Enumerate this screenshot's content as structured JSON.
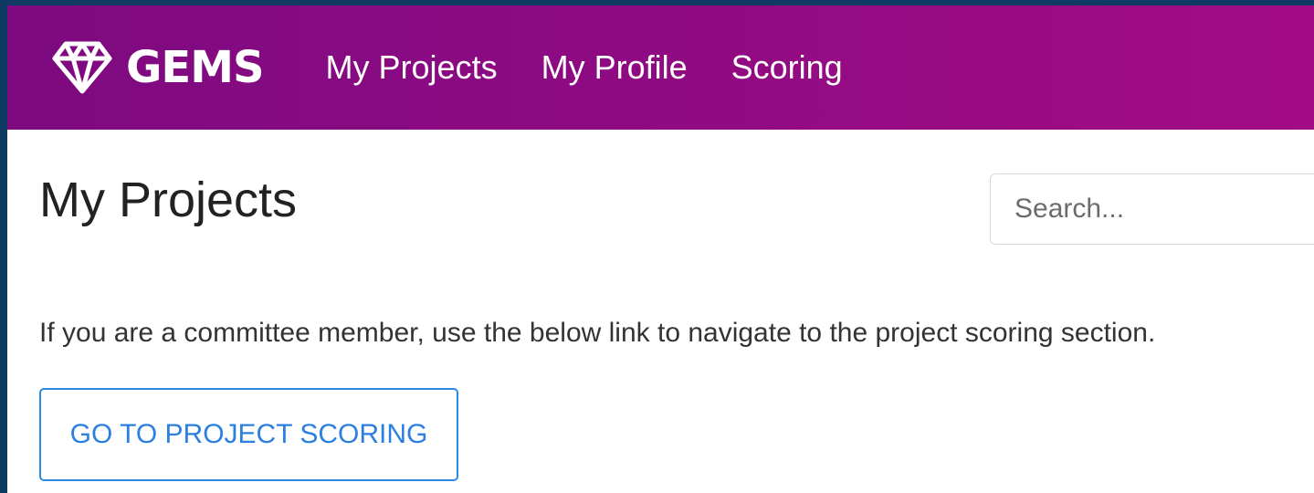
{
  "brand": {
    "logo_icon": "diamond-icon",
    "name": "GEMS"
  },
  "nav": {
    "items": [
      {
        "label": "My Projects"
      },
      {
        "label": "My Profile"
      },
      {
        "label": "Scoring"
      }
    ]
  },
  "main": {
    "title": "My Projects",
    "search": {
      "placeholder": "Search...",
      "value": ""
    },
    "info_text": "If you are a committee member, use the below link to navigate to the project scoring section.",
    "scoring_button_label": "GO TO PROJECT SCORING"
  },
  "colors": {
    "nav_gradient_start": "#7d0a80",
    "nav_gradient_end": "#a20c84",
    "button_accent": "#2b89e6",
    "outer_background": "#0e3a63"
  }
}
